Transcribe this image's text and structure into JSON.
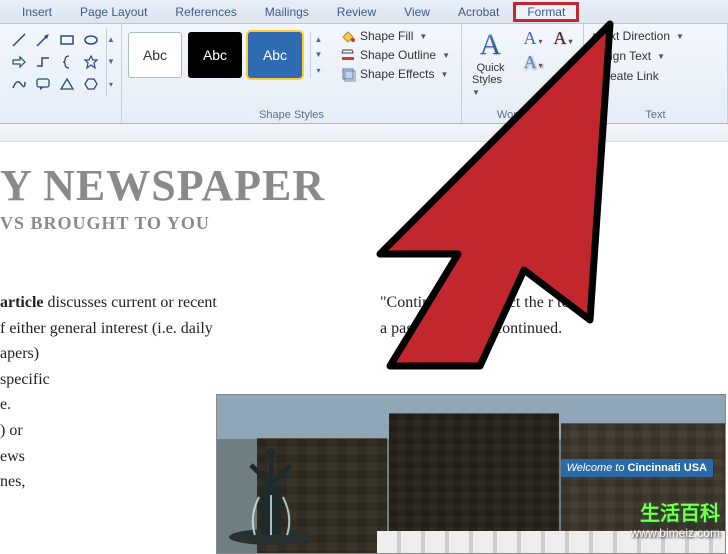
{
  "tabs": {
    "insert": "Insert",
    "pagelayout": "Page Layout",
    "references": "References",
    "mailings": "Mailings",
    "review": "Review",
    "view": "View",
    "acrobat": "Acrobat",
    "format": "Format"
  },
  "shapestyles": {
    "group_label": "Shape Styles",
    "abc": "Abc",
    "fill": "Shape Fill",
    "outline": "Shape Outline",
    "effects": "Shape Effects"
  },
  "wordart": {
    "group_label": "WordArt…",
    "quick": "Quick",
    "styles": "Styles"
  },
  "textgroup": {
    "group_label": "Text",
    "direction": "xt Direction",
    "align": "ign Text",
    "link": "eate Link"
  },
  "doc": {
    "title": "Y NEWSPAPER",
    "subtitle": "VS BROUGHT TO YOU",
    "left_line1_a": "article",
    "left_line1_b": " discusses current or recent",
    "left_line2": "f either general interest (i.e. daily",
    "left_line3": "apers)",
    "left_line4": "specific",
    "left_line5": "e.",
    "left_line6": ") or",
    "left_line7": "ews",
    "left_line8": "nes,",
    "right_line1": "\"Continued on pa          rect the           r to",
    "right_line2": "a page where th              s continued."
  },
  "photo": {
    "banner_a": "Welcome to",
    "banner_b": "Cincinnati USA"
  },
  "watermark": {
    "cn": "生活百科",
    "url": "www.bimeiz.com"
  }
}
